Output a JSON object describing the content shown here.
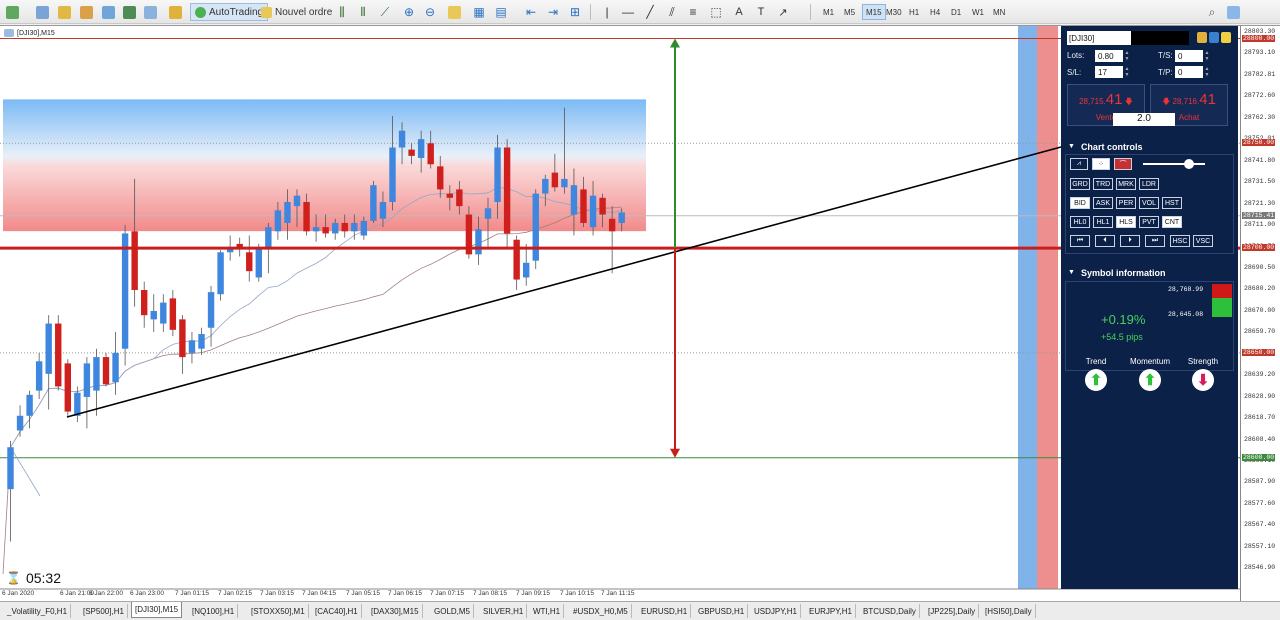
{
  "toolbar": {
    "autotrading_label": "AutoTrading",
    "new_order_label": "Nouvel ordre",
    "timeframes": [
      "M1",
      "M5",
      "M15",
      "M30",
      "H1",
      "H4",
      "D1",
      "W1",
      "MN"
    ],
    "active_timeframe": "M15"
  },
  "chart": {
    "title": "[DJI30],M15",
    "timer": "05:32",
    "price_labels": [
      "28803.30",
      "28793.10",
      "28782.81",
      "28772.60",
      "28762.30",
      "28752.01",
      "28741.80",
      "28731.50",
      "28721.30",
      "28711.00",
      "28700.70",
      "28690.50",
      "28680.20",
      "28670.00",
      "28659.70",
      "28649.41",
      "28639.20",
      "28628.90",
      "28618.70",
      "28608.40",
      "28598.10",
      "28587.90",
      "28577.60",
      "28567.40",
      "28557.10",
      "28546.90"
    ],
    "price_tags": [
      "28800.00",
      "28750.00",
      "28715.41",
      "28700.00",
      "28650.00",
      "28600.00"
    ],
    "time_labels": [
      "6 Jan 2020",
      "6 Jan 21:00",
      "6 Jan 22:00",
      "6 Jan 23:00",
      "7 Jan 01:15",
      "7 Jan 02:15",
      "7 Jan 03:15",
      "7 Jan 04:15",
      "7 Jan 05:15",
      "7 Jan 06:15",
      "7 Jan 07:15",
      "7 Jan 08:15",
      "7 Jan 09:15",
      "7 Jan 10:15",
      "7 Jan 11:15"
    ]
  },
  "panel": {
    "symbol": "[DJI30]",
    "lots_label": "Lots:",
    "lots_value": "0.80",
    "ts_label": "T/S:",
    "ts_value": "0",
    "sl_label": "S/L:",
    "sl_value": "17",
    "tp_label": "T/P:",
    "tp_value": "0",
    "sell_price_prefix": "28,715.",
    "sell_price_big": "41",
    "sell_label": "Vente",
    "buy_price_prefix": "28,716.",
    "buy_price_big": "41",
    "buy_label": "Achat",
    "lot_size": "2.0",
    "chart_controls_title": "Chart controls",
    "ctrl_row2": [
      "GRD",
      "TRD",
      "MRK",
      "LDR"
    ],
    "ctrl_row3": [
      "BID",
      "ASK",
      "PER",
      "VOL",
      "HST"
    ],
    "ctrl_row4": [
      "HL0",
      "HL1",
      "HLS",
      "PVT",
      "CNT"
    ],
    "ctrl_row5_extra": [
      "HSC",
      "VSC"
    ],
    "symbol_info_title": "Symbol information",
    "change_pct": "+0.19%",
    "change_pips": "+54.5 pips",
    "high": "28,768.99",
    "low": "28,645.08",
    "trend_label": "Trend",
    "momentum_label": "Momentum",
    "strength_label": "Strength"
  },
  "tabs": [
    "_Volatility_F0,H1",
    "[SP500],H1",
    "[DJI30],M15",
    "[NQ100],H1",
    "[STOXX50],M1",
    "[CAC40],H1",
    "[DAX30],M15",
    "GOLD,M5",
    "SILVER,H1",
    "WTI,H1",
    "#USDX_H0,M5",
    "EURUSD,H1",
    "GBPUSD,H1",
    "USDJPY,H1",
    "EURJPY,H1",
    "BTCUSD,Daily",
    "[JP225],Daily",
    "[HSI50],Daily"
  ],
  "active_tab": "[DJI30],M15",
  "colors": {
    "bull": "#3f86de",
    "bear": "#d0201e",
    "panel_bg": "#0c2148",
    "up_arrow": "#2ec03a",
    "down_arrow": "#d81b60"
  },
  "candles": [
    {
      "o": 28585,
      "h": 28608,
      "l": 28560,
      "c": 28605
    },
    {
      "o": 28613,
      "h": 28625,
      "l": 28610,
      "c": 28620
    },
    {
      "o": 28620,
      "h": 28632,
      "l": 28614,
      "c": 28630
    },
    {
      "o": 28632,
      "h": 28650,
      "l": 28628,
      "c": 28646
    },
    {
      "o": 28640,
      "h": 28668,
      "l": 28623,
      "c": 28664
    },
    {
      "o": 28664,
      "h": 28668,
      "l": 28632,
      "c": 28634
    },
    {
      "o": 28645,
      "h": 28647,
      "l": 28620,
      "c": 28622
    },
    {
      "o": 28620,
      "h": 28634,
      "l": 28617,
      "c": 28631
    },
    {
      "o": 28629,
      "h": 28648,
      "l": 28614,
      "c": 28645
    },
    {
      "o": 28632,
      "h": 28652,
      "l": 28620,
      "c": 28648
    },
    {
      "o": 28648,
      "h": 28650,
      "l": 28634,
      "c": 28635
    },
    {
      "o": 28636,
      "h": 28660,
      "l": 28630,
      "c": 28650
    },
    {
      "o": 28652,
      "h": 28711,
      "l": 28644,
      "c": 28707
    },
    {
      "o": 28708,
      "h": 28733,
      "l": 28672,
      "c": 28680
    },
    {
      "o": 28680,
      "h": 28684,
      "l": 28662,
      "c": 28668
    },
    {
      "o": 28666,
      "h": 28678,
      "l": 28660,
      "c": 28670
    },
    {
      "o": 28664,
      "h": 28678,
      "l": 28660,
      "c": 28674
    },
    {
      "o": 28676,
      "h": 28680,
      "l": 28658,
      "c": 28661
    },
    {
      "o": 28666,
      "h": 28668,
      "l": 28640,
      "c": 28648
    },
    {
      "o": 28650,
      "h": 28660,
      "l": 28645,
      "c": 28656
    },
    {
      "o": 28652,
      "h": 28662,
      "l": 28649,
      "c": 28659
    },
    {
      "o": 28662,
      "h": 28682,
      "l": 28653,
      "c": 28679
    },
    {
      "o": 28678,
      "h": 28699,
      "l": 28675,
      "c": 28698
    },
    {
      "o": 28698,
      "h": 28706,
      "l": 28694,
      "c": 28700
    },
    {
      "o": 28702,
      "h": 28705,
      "l": 28696,
      "c": 28700
    },
    {
      "o": 28698,
      "h": 28706,
      "l": 28684,
      "c": 28689
    },
    {
      "o": 28686,
      "h": 28702,
      "l": 28684,
      "c": 28700
    },
    {
      "o": 28700,
      "h": 28712,
      "l": 28688,
      "c": 28710
    },
    {
      "o": 28708,
      "h": 28722,
      "l": 28704,
      "c": 28718
    },
    {
      "o": 28712,
      "h": 28728,
      "l": 28704,
      "c": 28722
    },
    {
      "o": 28720,
      "h": 28728,
      "l": 28710,
      "c": 28725
    },
    {
      "o": 28722,
      "h": 28726,
      "l": 28706,
      "c": 28708
    },
    {
      "o": 28708,
      "h": 28716,
      "l": 28703,
      "c": 28710
    },
    {
      "o": 28710,
      "h": 28716,
      "l": 28705,
      "c": 28707
    },
    {
      "o": 28707,
      "h": 28714,
      "l": 28704,
      "c": 28712
    },
    {
      "o": 28712,
      "h": 28716,
      "l": 28705,
      "c": 28708
    },
    {
      "o": 28708,
      "h": 28716,
      "l": 28704,
      "c": 28712
    },
    {
      "o": 28706,
      "h": 28715,
      "l": 28704,
      "c": 28713
    },
    {
      "o": 28713,
      "h": 28732,
      "l": 28712,
      "c": 28730
    },
    {
      "o": 28714,
      "h": 28727,
      "l": 28710,
      "c": 28722
    },
    {
      "o": 28722,
      "h": 28763,
      "l": 28718,
      "c": 28748
    },
    {
      "o": 28748,
      "h": 28760,
      "l": 28740,
      "c": 28756
    },
    {
      "o": 28747,
      "h": 28750,
      "l": 28740,
      "c": 28744
    },
    {
      "o": 28743,
      "h": 28756,
      "l": 28736,
      "c": 28752
    },
    {
      "o": 28750,
      "h": 28756,
      "l": 28738,
      "c": 28740
    },
    {
      "o": 28739,
      "h": 28744,
      "l": 28724,
      "c": 28728
    },
    {
      "o": 28726,
      "h": 28730,
      "l": 28718,
      "c": 28724
    },
    {
      "o": 28728,
      "h": 28732,
      "l": 28716,
      "c": 28720
    },
    {
      "o": 28716,
      "h": 28720,
      "l": 28695,
      "c": 28697
    },
    {
      "o": 28697,
      "h": 28715,
      "l": 28692,
      "c": 28709
    },
    {
      "o": 28714,
      "h": 28724,
      "l": 28700,
      "c": 28719
    },
    {
      "o": 28722,
      "h": 28754,
      "l": 28714,
      "c": 28748
    },
    {
      "o": 28748,
      "h": 28752,
      "l": 28700,
      "c": 28707
    },
    {
      "o": 28704,
      "h": 28706,
      "l": 28680,
      "c": 28685
    },
    {
      "o": 28686,
      "h": 28702,
      "l": 28682,
      "c": 28693
    },
    {
      "o": 28694,
      "h": 28728,
      "l": 28690,
      "c": 28726
    },
    {
      "o": 28726,
      "h": 28735,
      "l": 28720,
      "c": 28733
    },
    {
      "o": 28736,
      "h": 28745,
      "l": 28727,
      "c": 28729
    },
    {
      "o": 28729,
      "h": 28767,
      "l": 28726,
      "c": 28733
    },
    {
      "o": 28716,
      "h": 28738,
      "l": 28706,
      "c": 28730
    },
    {
      "o": 28728,
      "h": 28734,
      "l": 28710,
      "c": 28712
    },
    {
      "o": 28710,
      "h": 28732,
      "l": 28706,
      "c": 28725
    },
    {
      "o": 28724,
      "h": 28726,
      "l": 28710,
      "c": 28716
    },
    {
      "o": 28714,
      "h": 28720,
      "l": 28688,
      "c": 28708
    },
    {
      "o": 28712,
      "h": 28719,
      "l": 28708,
      "c": 28717
    }
  ]
}
